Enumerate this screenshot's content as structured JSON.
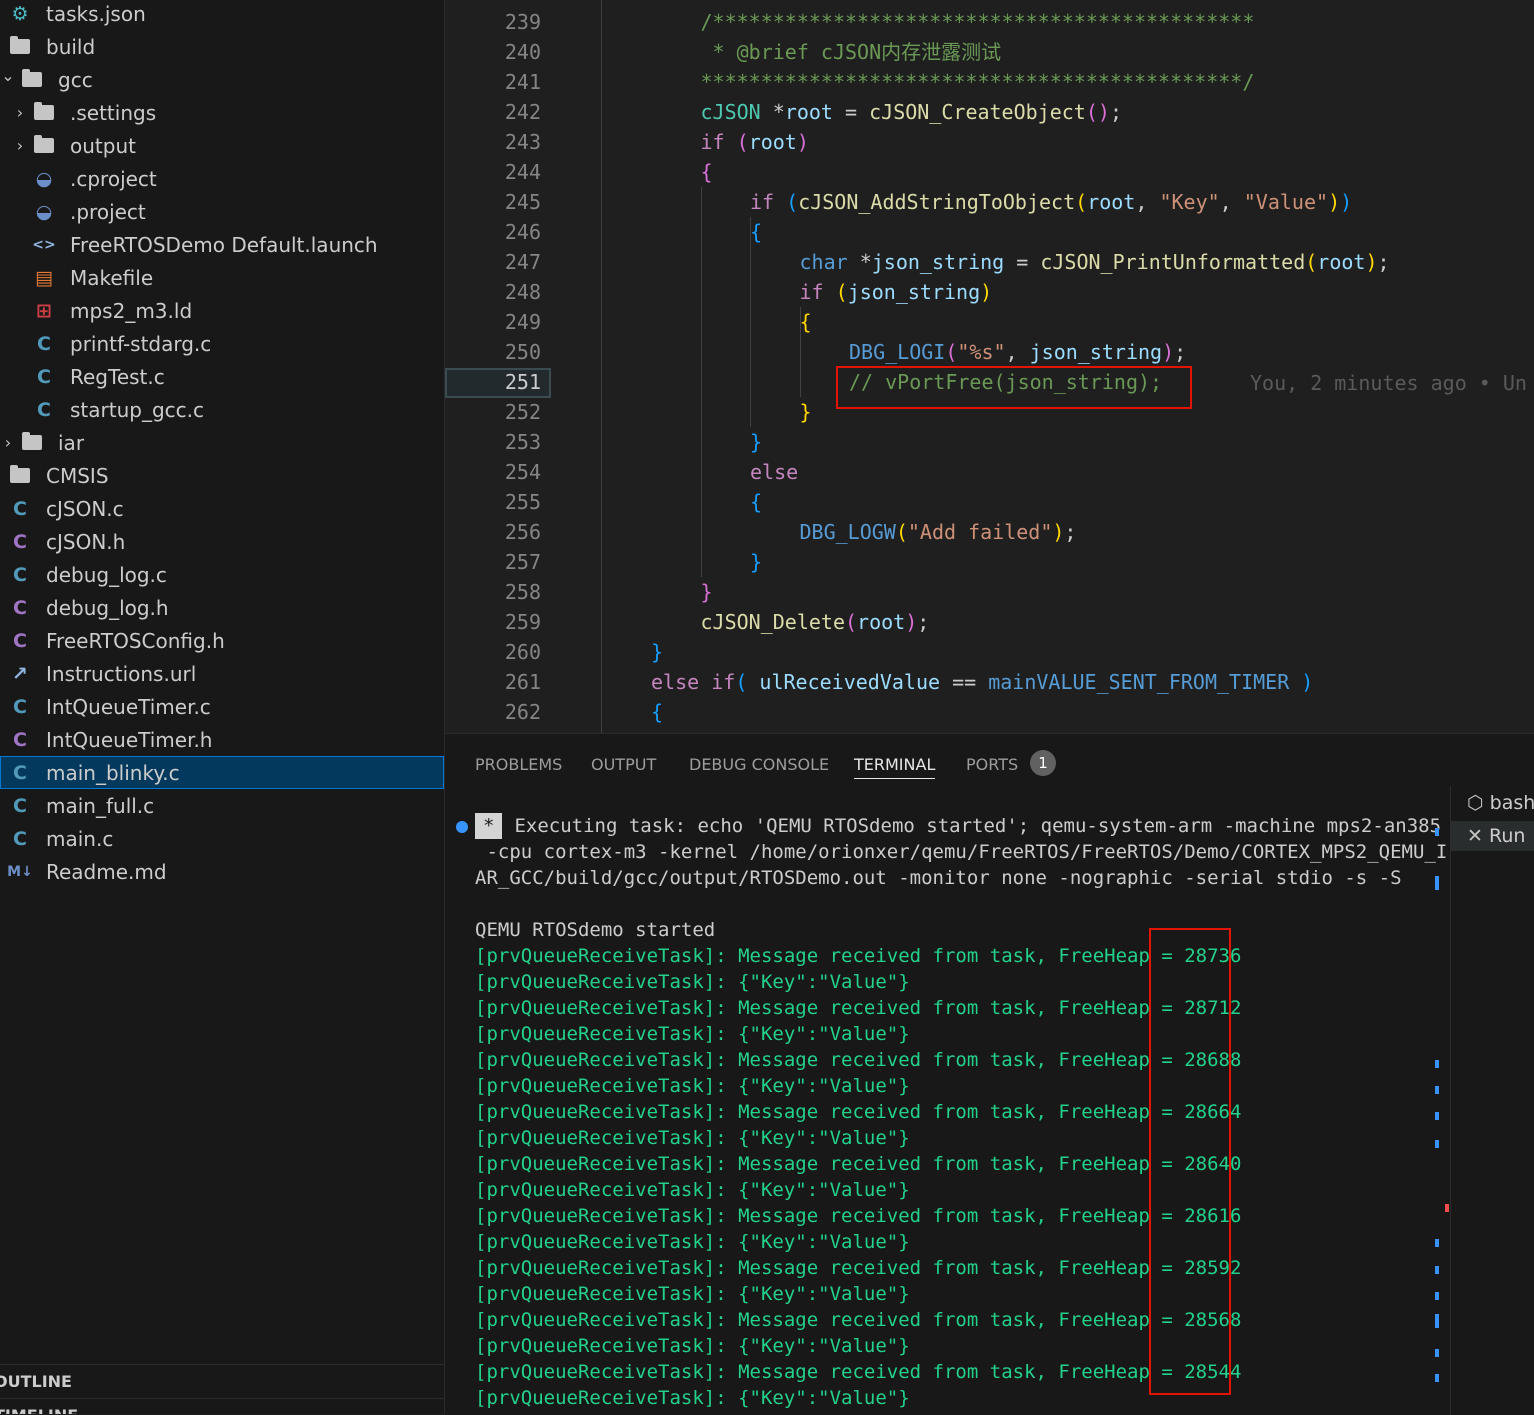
{
  "explorer": {
    "items": [
      {
        "label": "tasks.json",
        "icon": "settings-json-icon",
        "indent": 0,
        "kind": "file"
      },
      {
        "label": "build",
        "icon": "folder-icon",
        "indent": 0,
        "kind": "folder",
        "expanded": true
      },
      {
        "label": "gcc",
        "icon": "folder-icon",
        "indent": 1,
        "kind": "folder",
        "expanded": true
      },
      {
        "label": ".settings",
        "icon": "folder-icon",
        "indent": 2,
        "kind": "folder",
        "expanded": false
      },
      {
        "label": "output",
        "icon": "folder-icon",
        "indent": 2,
        "kind": "folder",
        "expanded": false
      },
      {
        "label": ".cproject",
        "icon": "eclipse-icon",
        "indent": 2,
        "kind": "file"
      },
      {
        "label": ".project",
        "icon": "eclipse-icon",
        "indent": 2,
        "kind": "file"
      },
      {
        "label": "FreeRTOSDemo Default.launch",
        "icon": "xml-code-icon",
        "indent": 2,
        "kind": "file"
      },
      {
        "label": "Makefile",
        "icon": "makefile-icon",
        "indent": 2,
        "kind": "file"
      },
      {
        "label": "mps2_m3.ld",
        "icon": "linker-icon",
        "indent": 2,
        "kind": "file"
      },
      {
        "label": "printf-stdarg.c",
        "icon": "c-file-icon",
        "indent": 2,
        "kind": "file"
      },
      {
        "label": "RegTest.c",
        "icon": "c-file-icon",
        "indent": 2,
        "kind": "file"
      },
      {
        "label": "startup_gcc.c",
        "icon": "c-file-icon",
        "indent": 2,
        "kind": "file"
      },
      {
        "label": "iar",
        "icon": "folder-icon",
        "indent": 1,
        "kind": "folder",
        "expanded": false
      },
      {
        "label": "CMSIS",
        "icon": "folder-icon",
        "indent": 0,
        "kind": "folder",
        "expanded": false
      },
      {
        "label": "cJSON.c",
        "icon": "c-file-icon",
        "indent": 0,
        "kind": "file"
      },
      {
        "label": "cJSON.h",
        "icon": "h-file-icon",
        "indent": 0,
        "kind": "file"
      },
      {
        "label": "debug_log.c",
        "icon": "c-file-icon",
        "indent": 0,
        "kind": "file"
      },
      {
        "label": "debug_log.h",
        "icon": "h-file-icon",
        "indent": 0,
        "kind": "file"
      },
      {
        "label": "FreeRTOSConfig.h",
        "icon": "h-file-icon",
        "indent": 0,
        "kind": "file"
      },
      {
        "label": "Instructions.url",
        "icon": "url-file-icon",
        "indent": 0,
        "kind": "file"
      },
      {
        "label": "IntQueueTimer.c",
        "icon": "c-file-icon",
        "indent": 0,
        "kind": "file"
      },
      {
        "label": "IntQueueTimer.h",
        "icon": "h-file-icon",
        "indent": 0,
        "kind": "file"
      },
      {
        "label": "main_blinky.c",
        "icon": "c-file-icon",
        "indent": 0,
        "kind": "file",
        "selected": true
      },
      {
        "label": "main_full.c",
        "icon": "c-file-icon",
        "indent": 0,
        "kind": "file"
      },
      {
        "label": "main.c",
        "icon": "c-file-icon",
        "indent": 0,
        "kind": "file"
      },
      {
        "label": "Readme.md",
        "icon": "markdown-icon",
        "indent": 0,
        "kind": "file"
      }
    ],
    "outline_label": "OUTLINE",
    "timeline_label": "TIMELINE"
  },
  "editor": {
    "line_numbers": [
      "239",
      "240",
      "241",
      "242",
      "243",
      "244",
      "245",
      "246",
      "247",
      "248",
      "249",
      "250",
      "251",
      "252",
      "253",
      "254",
      "255",
      "256",
      "257",
      "258",
      "259",
      "260",
      "261",
      "262"
    ],
    "active_line": "251",
    "blame": "You, 2 minutes ago • Un",
    "lines": [
      {
        "indent": 1,
        "tokens": [
          [
            "/*********************************************",
            "cmt"
          ]
        ]
      },
      {
        "indent": 1,
        "tokens": [
          [
            " * @brief cJSON内存泄露测试",
            "cmt"
          ]
        ]
      },
      {
        "indent": 1,
        "tokens": [
          [
            "*********************************************/",
            "cmt"
          ]
        ]
      },
      {
        "indent": 1,
        "tokens": [
          [
            "cJSON",
            "type"
          ],
          [
            " *",
            "txt"
          ],
          [
            "root",
            "var"
          ],
          [
            " = ",
            "txt"
          ],
          [
            "cJSON_CreateObject",
            "fn"
          ],
          [
            "()",
            "brace-p"
          ],
          [
            ";",
            "txt"
          ]
        ]
      },
      {
        "indent": 1,
        "tokens": [
          [
            "if",
            "kw2"
          ],
          [
            " ",
            "txt"
          ],
          [
            "(",
            "brace-p"
          ],
          [
            "root",
            "var"
          ],
          [
            ")",
            "brace-p"
          ]
        ]
      },
      {
        "indent": 1,
        "tokens": [
          [
            "{",
            "brace-p"
          ]
        ]
      },
      {
        "indent": 2,
        "tokens": [
          [
            "if",
            "kw2"
          ],
          [
            " ",
            "txt"
          ],
          [
            "(",
            "brace-b"
          ],
          [
            "cJSON_AddStringToObject",
            "fn"
          ],
          [
            "(",
            "brace-y"
          ],
          [
            "root",
            "var"
          ],
          [
            ", ",
            "txt"
          ],
          [
            "\"Key\"",
            "str"
          ],
          [
            ", ",
            "txt"
          ],
          [
            "\"Value\"",
            "str"
          ],
          [
            ")",
            "brace-y"
          ],
          [
            ")",
            "brace-b"
          ]
        ]
      },
      {
        "indent": 2,
        "tokens": [
          [
            "{",
            "brace-b"
          ]
        ]
      },
      {
        "indent": 3,
        "tokens": [
          [
            "char",
            "kw"
          ],
          [
            " *",
            "txt"
          ],
          [
            "json_string",
            "var"
          ],
          [
            " = ",
            "txt"
          ],
          [
            "cJSON_PrintUnformatted",
            "fn"
          ],
          [
            "(",
            "brace-y"
          ],
          [
            "root",
            "var"
          ],
          [
            ")",
            "brace-y"
          ],
          [
            ";",
            "txt"
          ]
        ]
      },
      {
        "indent": 3,
        "tokens": [
          [
            "if",
            "kw2"
          ],
          [
            " ",
            "txt"
          ],
          [
            "(",
            "brace-y"
          ],
          [
            "json_string",
            "var"
          ],
          [
            ")",
            "brace-y"
          ]
        ]
      },
      {
        "indent": 3,
        "tokens": [
          [
            "{",
            "brace-y"
          ]
        ]
      },
      {
        "indent": 4,
        "tokens": [
          [
            "DBG_LOGI",
            "mac"
          ],
          [
            "(",
            "brace-p"
          ],
          [
            "\"%s\"",
            "str"
          ],
          [
            ", ",
            "txt"
          ],
          [
            "json_string",
            "var"
          ],
          [
            ")",
            "brace-p"
          ],
          [
            ";",
            "txt"
          ]
        ]
      },
      {
        "indent": 4,
        "tokens": [
          [
            "// vPortFree(json_string);",
            "cmt"
          ]
        ]
      },
      {
        "indent": 3,
        "tokens": [
          [
            "}",
            "brace-y"
          ]
        ]
      },
      {
        "indent": 2,
        "tokens": [
          [
            "}",
            "brace-b"
          ]
        ]
      },
      {
        "indent": 2,
        "tokens": [
          [
            "else",
            "kw2"
          ]
        ]
      },
      {
        "indent": 2,
        "tokens": [
          [
            "{",
            "brace-b"
          ]
        ]
      },
      {
        "indent": 3,
        "tokens": [
          [
            "DBG_LOGW",
            "mac"
          ],
          [
            "(",
            "brace-y"
          ],
          [
            "\"Add failed\"",
            "str"
          ],
          [
            ")",
            "brace-y"
          ],
          [
            ";",
            "txt"
          ]
        ]
      },
      {
        "indent": 2,
        "tokens": [
          [
            "}",
            "brace-b"
          ]
        ]
      },
      {
        "indent": 1,
        "tokens": [
          [
            "}",
            "brace-p"
          ]
        ]
      },
      {
        "indent": 1,
        "tokens": [
          [
            "cJSON_Delete",
            "fn"
          ],
          [
            "(",
            "brace-p"
          ],
          [
            "root",
            "var"
          ],
          [
            ")",
            "brace-p"
          ],
          [
            ";",
            "txt"
          ]
        ]
      },
      {
        "indent": 0,
        "tokens": [
          [
            "}",
            "brace-b"
          ]
        ]
      },
      {
        "indent": 0,
        "tokens": [
          [
            "else",
            "kw2"
          ],
          [
            " ",
            "txt"
          ],
          [
            "if",
            "kw2"
          ],
          [
            "( ",
            "brace-b"
          ],
          [
            "ulReceivedValue",
            "var"
          ],
          [
            " == ",
            "txt"
          ],
          [
            "mainVALUE_SENT_FROM_TIMER",
            "mac"
          ],
          [
            " )",
            "brace-b"
          ]
        ]
      },
      {
        "indent": 0,
        "tokens": [
          [
            "{",
            "brace-b"
          ]
        ]
      }
    ]
  },
  "panel": {
    "tabs": [
      {
        "label": "PROBLEMS",
        "active": false
      },
      {
        "label": "OUTPUT",
        "active": false
      },
      {
        "label": "DEBUG CONSOLE",
        "active": false
      },
      {
        "label": "TERMINAL",
        "active": true
      },
      {
        "label": "PORTS",
        "active": false
      }
    ],
    "ports_badge": "1",
    "terminal": {
      "exec_star": "*",
      "exec_lines": [
        "Executing task: echo 'QEMU RTOSdemo started'; qemu-system-arm -machine mps2-an385",
        " -cpu cortex-m3 -kernel /home/orionxer/qemu/FreeRTOS/FreeRTOS/Demo/CORTEX_MPS2_QEMU_I",
        "AR_GCC/build/gcc/output/RTOSDemo.out -monitor none -nographic -serial stdio -s -S"
      ],
      "started": "QEMU RTOSdemo started",
      "message_prefix": "[prvQueueReceiveTask]: Message received from task, FreeHeap = ",
      "json_line": "[prvQueueReceiveTask]: {\"Key\":\"Value\"}",
      "free_heap": [
        "28736",
        "28712",
        "28688",
        "28664",
        "28640",
        "28616",
        "28592",
        "28568",
        "28544"
      ]
    },
    "terminal_list": [
      {
        "label": "bash",
        "icon": "terminal-icon"
      },
      {
        "label": "Run",
        "icon": "tools-icon"
      }
    ]
  }
}
